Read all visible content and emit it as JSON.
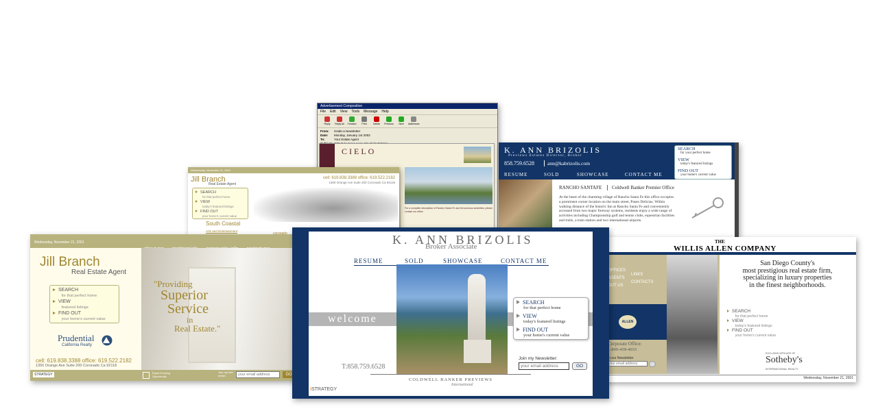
{
  "email_client": {
    "title": "Advertisement Composition",
    "menu": [
      "File",
      "Edit",
      "View",
      "Tools",
      "Message",
      "Help"
    ],
    "toolbar": [
      "Reply",
      "Reply All",
      "Forward",
      "Print",
      "Delete",
      "Previous",
      "Next",
      "Addresses"
    ],
    "headers": [
      {
        "k": "From:",
        "v": "inside-a Newsletter"
      },
      {
        "k": "Date:",
        "v": "Monday, January 1st 2002"
      },
      {
        "k": "To:",
        "v": "Your Estate Agent"
      },
      {
        "k": "Subject:",
        "v": "CIELO to move soon. 5% Cielo Estates"
      }
    ],
    "logo": "CIELO",
    "caption": "For a complete description of Rancho Santa Fe and its luxurious amenities, please contact our office."
  },
  "brizolis_top": {
    "name": "K. Ann Brizolis",
    "subtitle": "Previews Estates Director, Broker",
    "phone": "858.759.6528",
    "email": "ann@kabrizolis.com",
    "nav": [
      "Resume",
      "Sold",
      "Showcase",
      "Contact Me"
    ],
    "panel": [
      {
        "label": "Search",
        "sub": "for your perfect home"
      },
      {
        "label": "View",
        "sub": "today's featured listings"
      },
      {
        "label": "Find Out",
        "sub": "your home's current value"
      }
    ],
    "heading_left": "RANCHO SANTAFE",
    "heading_right": "Coldwell Banker Premier Office",
    "body": "At the heart of the charming village of Rancho Santa Fe this office occupies a prominent corner location on the main street, Paseo Delicias. Within walking distance of the historic Inn at Rancho Santa Fe and conveniently accessed from two major freeway systems, residents enjoy a wide range of activities including Championship golf and tennis clubs, equestrian facilities and trails, a train station and two international airports."
  },
  "jill_back": {
    "date": "Wednesday, November 21, 2001",
    "nav": [
      "about me",
      "testimonials",
      "community info",
      "contact me"
    ],
    "name": "Jill Branch",
    "title": "Real Estate Agent",
    "contact": "cell: 619.838.3388 office: 619.522.2182",
    "address": "1350 Orange Ave Suite 200 Coronado Ca 92118",
    "panel": [
      {
        "label": "Search",
        "sub": "for that perfect home"
      },
      {
        "label": "View",
        "sub": "today's featured listings"
      },
      {
        "label": "Find Out",
        "sub": "your home's current value"
      }
    ],
    "section": "South Coastal",
    "links": [
      "coronado",
      "ocean beach",
      "pacific beach",
      "point loma"
    ],
    "subsection": "Arts and Entertainment"
  },
  "jill_front": {
    "date": "Wednesday, November 21, 2001",
    "nav": [
      "about me",
      "testimonials",
      "community info",
      "contact me"
    ],
    "name": "Jill Branch",
    "title": "Real Estate Agent",
    "panel": [
      {
        "label": "Search",
        "sub": "for that perfect home"
      },
      {
        "label": "View",
        "sub": "featured listings"
      },
      {
        "label": "Find Out",
        "sub": "your home's current value"
      }
    ],
    "brand": "Prudential",
    "brand_sub": "California Realty",
    "contact": "cell: 619.838.3388 office: 619.522.2182",
    "address": "1350 Orange Ave Suite 200 Coronado Ca 92118",
    "quote_1": "\"Providing",
    "quote_2": "Superior",
    "quote_3": "Service",
    "quote_4": "in",
    "quote_5": "Real Estate.\"",
    "strategy": "STRATEGY",
    "equal_housing": "Equal Housing Opportunity",
    "newsletter": "Join my free eletter",
    "email_placeholder": "your email address",
    "go": "GO"
  },
  "willis": {
    "the": "THE",
    "name": "WILLIS ALLEN COMPANY",
    "tagline_1": "San Diego County's",
    "tagline_2": "most prestigious real estate firm,",
    "tagline_3": "specializing in luxury properties",
    "tagline_4": "in the finest neighborhoods.",
    "menu_left": [
      "OFFICES",
      "AGENTS",
      "OUT US"
    ],
    "menu_right": [
      "LINKS",
      "CONTACTS"
    ],
    "badge": "ALLEN",
    "corporate": "Corporate Office:",
    "phone": "1-800-459-4033",
    "newsletter": "in our Newsletter",
    "email_placeholder": "your email address",
    "panel": [
      {
        "label": "Search",
        "sub": "for that perfect home"
      },
      {
        "label": "View",
        "sub": "today's featured listings"
      },
      {
        "label": "Find Out",
        "sub": "your home's current value"
      }
    ],
    "affiliate": "EXCLUSIVE AFFILIATE OF",
    "sothebys": "Sotheby's",
    "sothebys_sub": "INTERNATIONAL REALTY",
    "date": "Wednesday, November 21, 2001"
  },
  "brizolis_main": {
    "name": "K. Ann Brizolis",
    "subtitle": "Broker Associate",
    "nav": [
      "Resume",
      "Sold",
      "Showcase",
      "Contact Me"
    ],
    "welcome": "welcome",
    "panel": [
      {
        "label": "Search",
        "sub": "for that perfect home"
      },
      {
        "label": "View",
        "sub": "today's featured listings"
      },
      {
        "label": "Find Out",
        "sub": "your home's current value"
      }
    ],
    "phone": "T:858.759.6528",
    "newsletter": "Join my Newsletter:",
    "email_placeholder": "your email address",
    "go": "GO",
    "coldwell": "Coldwell Banker Previews",
    "coldwell_sub": "International",
    "strategy": "STRATEGY"
  }
}
